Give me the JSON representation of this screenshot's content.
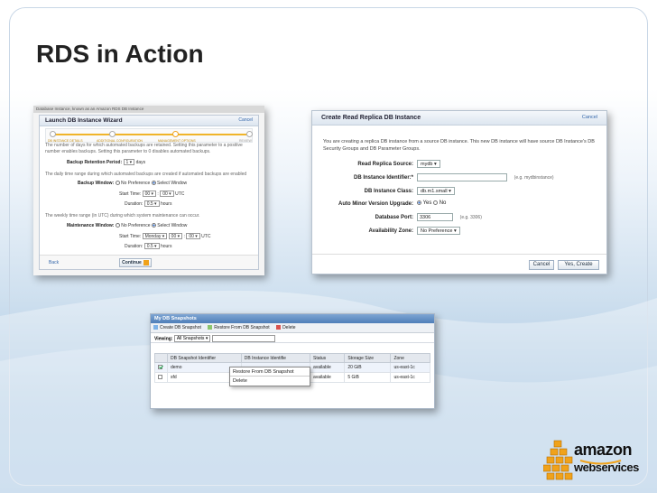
{
  "slide": {
    "title": "RDS in Action"
  },
  "wizard": {
    "breadcrumb": "Database Instance, known as an Amazon RDS DB Instance",
    "title": "Launch DB Instance Wizard",
    "cancel": "Cancel",
    "steps": [
      "DB INSTANCE DETAILS",
      "ADDITIONAL CONFIGURATION",
      "MANAGEMENT OPTIONS",
      "REVIEW"
    ],
    "retention_text": "The number of days for which automated backups are retained. Setting this parameter to a positive number enables backups. Setting this parameter to 0 disables automated backups.",
    "retention_label": "Backup Retention Period:",
    "retention_value": "1",
    "retention_unit": "days",
    "backup_text": "The daily time range during which automated backups are created if automated backups are enabled",
    "backup_label": "Backup Window:",
    "no_pref": "No Preference",
    "select_window": "Select Window",
    "start_time_label": "Start Time:",
    "start_hh": "00",
    "start_mm": "00",
    "utc": "UTC",
    "duration_label": "Duration:",
    "duration_value": "0.5",
    "hours": "hours",
    "maint_text": "The weekly time range (in UTC) during which system maintenance can occur.",
    "maint_label": "Maintenance Window:",
    "day_value": "Monday",
    "back": "Back",
    "continue": "Continue"
  },
  "replica": {
    "title": "Create Read Replica DB Instance",
    "cancel": "Cancel",
    "description": "You are creating a replica DB instance from a source DB instance. This new DB instance will have source DB Instance's DB Security Groups and DB Parameter Groups.",
    "source_label": "Read Replica Source:",
    "source_value": "mydb",
    "identifier_label": "DB Instance Identifier:*",
    "identifier_hint": "(e.g. mydbinstance)",
    "class_label": "DB Instance Class:",
    "class_value": "db.m1.small",
    "auto_minor_label": "Auto Minor Version Upgrade:",
    "yes": "Yes",
    "no": "No",
    "port_label": "Database Port:",
    "port_value": "3306",
    "port_hint": "(e.g. 3306)",
    "az_label": "Availability Zone:",
    "az_value": "No Preference",
    "cancel_button": "Cancel",
    "create_button": "Yes, Create"
  },
  "snapshots": {
    "title": "My DB Snapshots",
    "toolbar": {
      "create": "Create DB Snapshot",
      "restore": "Restore From DB Snapshot",
      "delete": "Delete"
    },
    "viewing_label": "Viewing:",
    "viewing_value": "All Snapshots",
    "columns": [
      "",
      "DB Snapshot Identifier",
      "DB Instance Identifie",
      "Status",
      "Storage Size",
      "Zone"
    ],
    "rows": [
      {
        "id": "demo",
        "instance": "",
        "status": "available",
        "size": "20 GiB",
        "zone": "us-east-1c"
      },
      {
        "id": "sfd",
        "instance": "",
        "status": "available",
        "size": "5 GiB",
        "zone": "us-east-1c"
      }
    ],
    "context_menu": [
      "Restore From DB Snapshot",
      "Delete"
    ]
  },
  "logo": {
    "line1": "amazon",
    "line2": "webservices"
  },
  "colors": {
    "aws_orange": "#f0a21b",
    "link": "#3366aa"
  }
}
